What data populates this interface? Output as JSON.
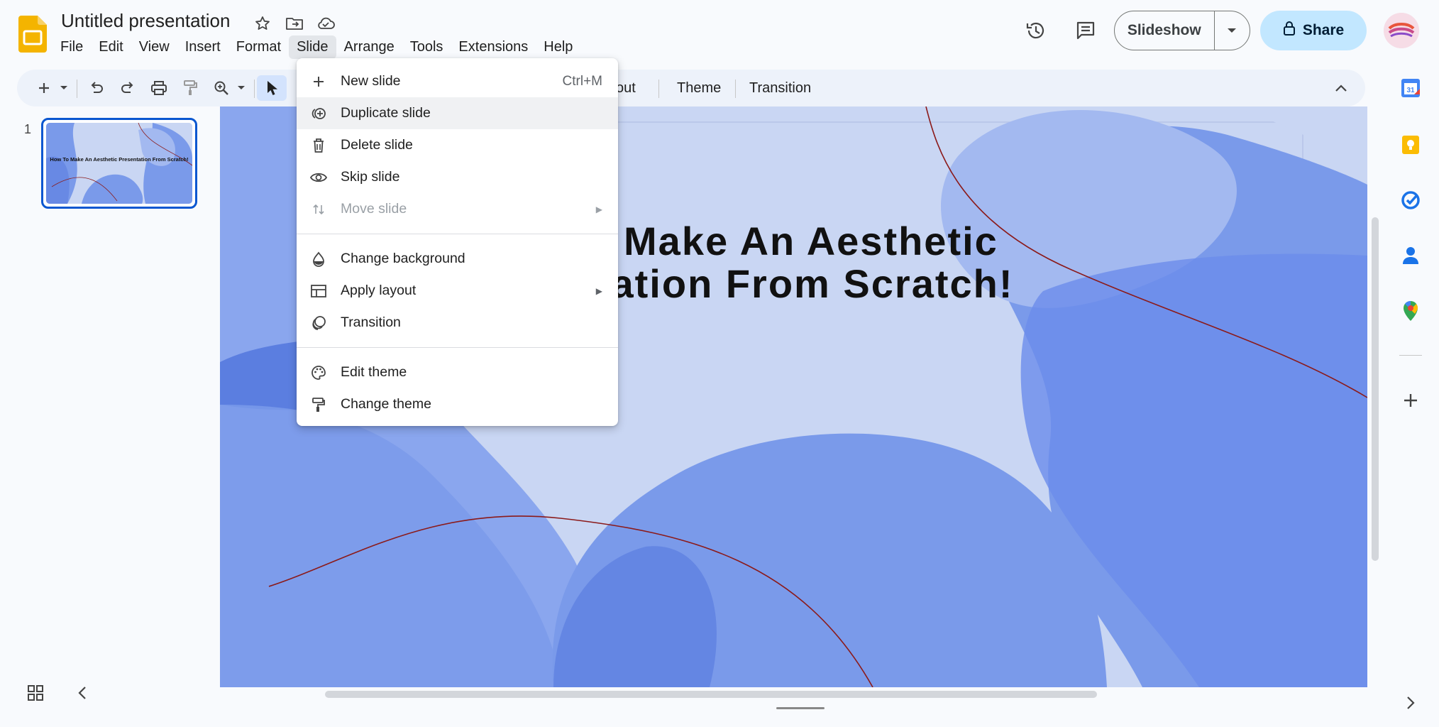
{
  "app": {
    "doc_title": "Untitled presentation"
  },
  "menubar": [
    "File",
    "Edit",
    "View",
    "Insert",
    "Format",
    "Slide",
    "Arrange",
    "Tools",
    "Extensions",
    "Help"
  ],
  "menubar_active": "Slide",
  "header": {
    "slideshow_label": "Slideshow",
    "share_label": "Share"
  },
  "toolbar": {
    "layout_partial": "out",
    "theme_label": "Theme",
    "transition_label": "Transition"
  },
  "filmstrip": {
    "slide_number": "1",
    "thumb_text": "How To Make An Aesthetic Presentation From Scratch!"
  },
  "slide": {
    "title_line1": "To  Make An Aesthetic",
    "title_line2": "entation From Scratch!"
  },
  "slide_menu": {
    "items": [
      {
        "label": "New slide",
        "shortcut": "Ctrl+M",
        "icon": "plus-icon"
      },
      {
        "label": "Duplicate slide",
        "icon": "duplicate-icon"
      },
      {
        "label": "Delete slide",
        "icon": "trash-icon"
      },
      {
        "label": "Skip slide",
        "icon": "eye-icon"
      },
      {
        "label": "Move slide",
        "icon": "move-icon"
      },
      {
        "label": "Change background",
        "icon": "drop-icon"
      },
      {
        "label": "Apply layout",
        "icon": "layout-icon"
      },
      {
        "label": "Transition",
        "icon": "transition-icon"
      },
      {
        "label": "Edit theme",
        "icon": "palette-icon"
      },
      {
        "label": "Change theme",
        "icon": "paint-roller-icon"
      }
    ],
    "hovered": "Duplicate slide",
    "disabled": "Move slide"
  },
  "colors": {
    "accent": "#0b57d0",
    "share_bg": "#c2e7ff",
    "slide_bg": "#c9d6f3",
    "blob_dark": "#5b7ee0",
    "blob_mid": "#7a9aea",
    "curve": "#8b1a1a"
  }
}
